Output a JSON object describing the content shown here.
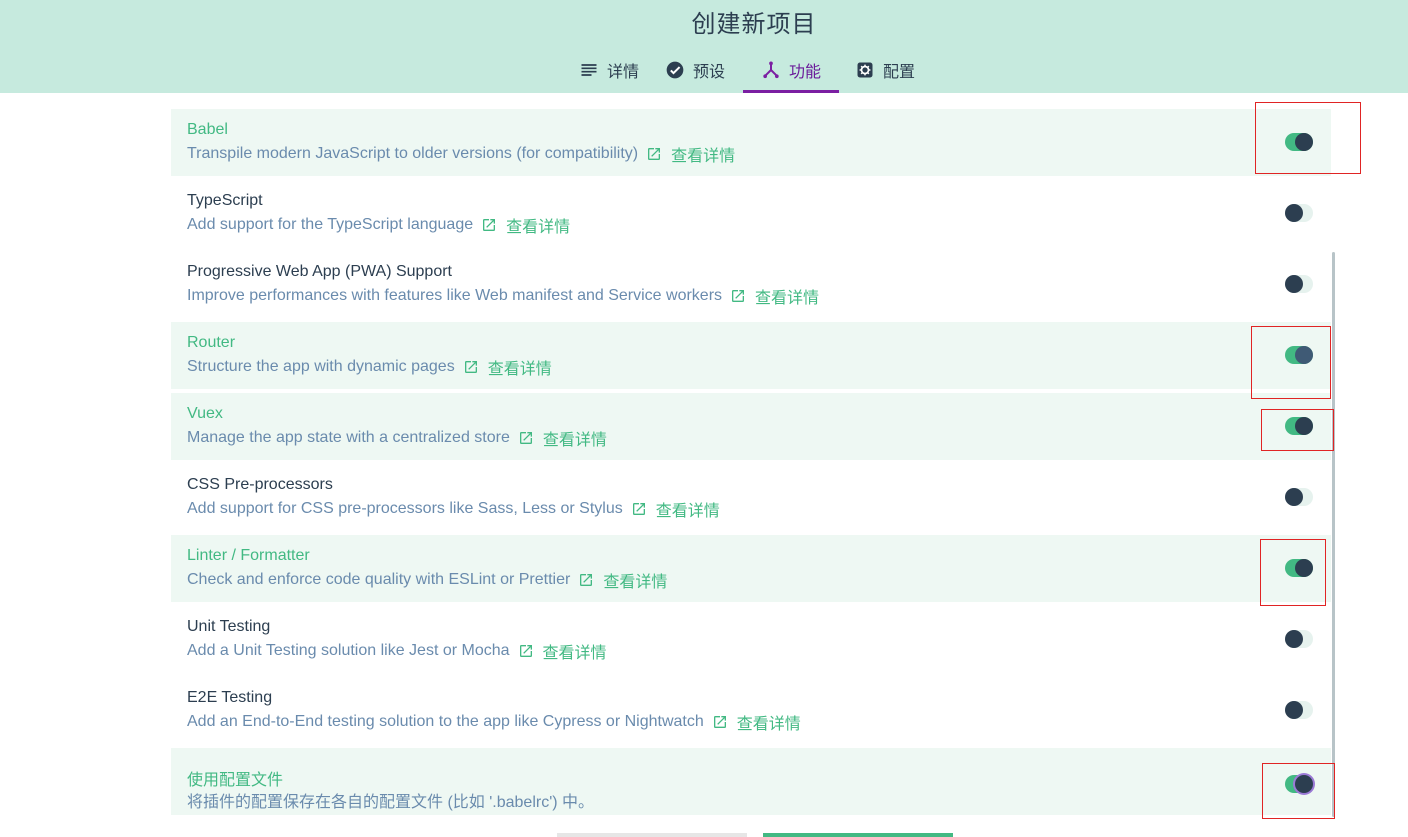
{
  "header": {
    "title": "创建新项目",
    "tabs": [
      {
        "label": "详情",
        "icon": "list-icon",
        "active": false
      },
      {
        "label": "预设",
        "icon": "check-circle-icon",
        "active": false
      },
      {
        "label": "功能",
        "icon": "call-split-icon",
        "active": true
      },
      {
        "label": "配置",
        "icon": "settings-icon",
        "active": false
      }
    ]
  },
  "colors": {
    "header_bg": "#c6eade",
    "accent": "#42b983",
    "active_tab": "#7b1fa2",
    "text_dark": "#2c3e50",
    "text_desc": "#6a8bad",
    "selected_row_bg": "#eef8f3"
  },
  "features": {
    "more_label": "查看详情",
    "items": [
      {
        "name": "Babel",
        "desc": "Transpile modern JavaScript to older versions (for compatibility)",
        "enabled": true,
        "has_link": true
      },
      {
        "name": "TypeScript",
        "desc": "Add support for the TypeScript language",
        "enabled": false,
        "has_link": true
      },
      {
        "name": "Progressive Web App (PWA) Support",
        "desc": "Improve performances with features like Web manifest and Service workers",
        "enabled": false,
        "has_link": true
      },
      {
        "name": "Router",
        "desc": "Structure the app with dynamic pages",
        "enabled": true,
        "has_link": true
      },
      {
        "name": "Vuex",
        "desc": "Manage the app state with a centralized store",
        "enabled": true,
        "has_link": true
      },
      {
        "name": "CSS Pre-processors",
        "desc": "Add support for CSS pre-processors like Sass, Less or Stylus",
        "enabled": false,
        "has_link": true
      },
      {
        "name": "Linter / Formatter",
        "desc": "Check and enforce code quality with ESLint or Prettier",
        "enabled": true,
        "has_link": true
      },
      {
        "name": "Unit Testing",
        "desc": "Add a Unit Testing solution like Jest or Mocha",
        "enabled": false,
        "has_link": true
      },
      {
        "name": "E2E Testing",
        "desc": "Add an End-to-End testing solution to the app like Cypress or Nightwatch",
        "enabled": false,
        "has_link": true
      },
      {
        "name": "使用配置文件",
        "desc": "将插件的配置保存在各自的配置文件 (比如 '.babelrc') 中。",
        "enabled": true,
        "has_link": false
      }
    ]
  }
}
